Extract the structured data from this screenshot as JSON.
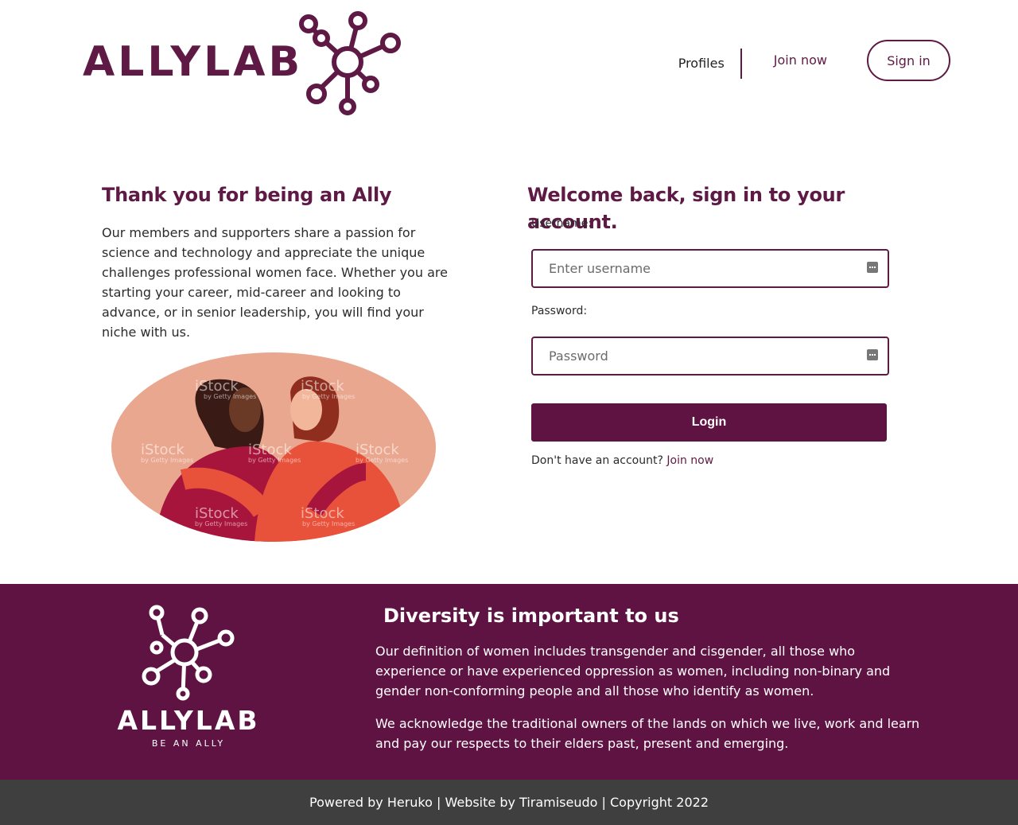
{
  "header": {
    "logo_text": "ALLYLAB",
    "nav": {
      "profiles": "Profiles",
      "join_now": "Join now",
      "sign_in": "Sign in"
    }
  },
  "intro": {
    "title": "Thank you for being an Ally",
    "body": "Our members and supporters share a passion for science and technology and appreciate the unique challenges professional women face. Whether you are starting your career, mid-career and looking to advance, or in senior leadership, you will find your niche with us.",
    "watermark": "iStock",
    "watermark_sub": "by Getty Images"
  },
  "login": {
    "title": "Welcome back, sign in to your account.",
    "username_label": "Username:",
    "username_placeholder": "Enter username",
    "password_label": "Password:",
    "password_placeholder": "Password",
    "button": "Login",
    "signup_prompt": "Don't have an account?",
    "signup_link": "Join now"
  },
  "footer": {
    "logo_text": "ALLYLAB",
    "tagline": "BE AN ALLY",
    "title": "Diversity is important to us",
    "para1": "Our definition of women includes transgender and cisgender, all those who experience or have experienced oppression as women, including non-binary and gender non-conforming people and all those who identify as women.",
    "para2": "We acknowledge the traditional owners of the lands on which we live, work and learn and pay our respects to their elders past, present and emerging.",
    "copyright": "Powered by Heruko | Website by Tiramiseudo | Copyright 2022"
  },
  "colors": {
    "brand": "#5e1342",
    "footer_bar": "#3f3f3f"
  }
}
